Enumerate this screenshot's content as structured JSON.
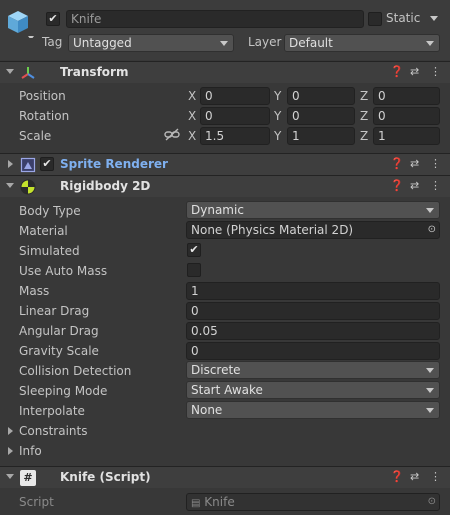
{
  "gameobject": {
    "active": true,
    "name": "Knife",
    "static_label": "Static",
    "tag_label": "Tag",
    "tag_value": "Untagged",
    "layer_label": "Layer",
    "layer_value": "Default"
  },
  "transform": {
    "title": "Transform",
    "position_label": "Position",
    "rotation_label": "Rotation",
    "scale_label": "Scale",
    "axis_x": "X",
    "axis_y": "Y",
    "axis_z": "Z",
    "position": {
      "x": "0",
      "y": "0",
      "z": "0"
    },
    "rotation": {
      "x": "0",
      "y": "0",
      "z": "0"
    },
    "scale": {
      "x": "1.5",
      "y": "1",
      "z": "1"
    }
  },
  "sprite_renderer": {
    "title": "Sprite Renderer",
    "enabled": true
  },
  "rigidbody2d": {
    "title": "Rigidbody 2D",
    "body_type_label": "Body Type",
    "body_type_value": "Dynamic",
    "material_label": "Material",
    "material_value": "None (Physics Material 2D)",
    "simulated_label": "Simulated",
    "simulated": true,
    "use_auto_mass_label": "Use Auto Mass",
    "use_auto_mass": false,
    "mass_label": "Mass",
    "mass_value": "1",
    "linear_drag_label": "Linear Drag",
    "linear_drag_value": "0",
    "angular_drag_label": "Angular Drag",
    "angular_drag_value": "0.05",
    "gravity_scale_label": "Gravity Scale",
    "gravity_scale_value": "0",
    "collision_detection_label": "Collision Detection",
    "collision_detection_value": "Discrete",
    "sleeping_mode_label": "Sleeping Mode",
    "sleeping_mode_value": "Start Awake",
    "interpolate_label": "Interpolate",
    "interpolate_value": "None",
    "constraints_label": "Constraints",
    "info_label": "Info"
  },
  "script": {
    "title": "Knife (Script)",
    "script_label": "Script",
    "script_value": "Knife"
  },
  "icons": {
    "cube": "gameobject-cube-icon",
    "help": "help-icon",
    "presets": "presets-icon",
    "menu": "kebab-menu-icon",
    "transform": "transform-axes-icon",
    "sprite": "sprite-renderer-icon",
    "rigidbody": "rigidbody2d-icon",
    "script": "script-hash-icon",
    "unlink": "unlink-scale-icon",
    "object_picker": "object-picker-icon"
  },
  "colors": {
    "background": "#383838",
    "component_header": "#3e3e3e",
    "field": "#2a2a2a",
    "sprite_renderer_title": "#7fb0ef"
  }
}
